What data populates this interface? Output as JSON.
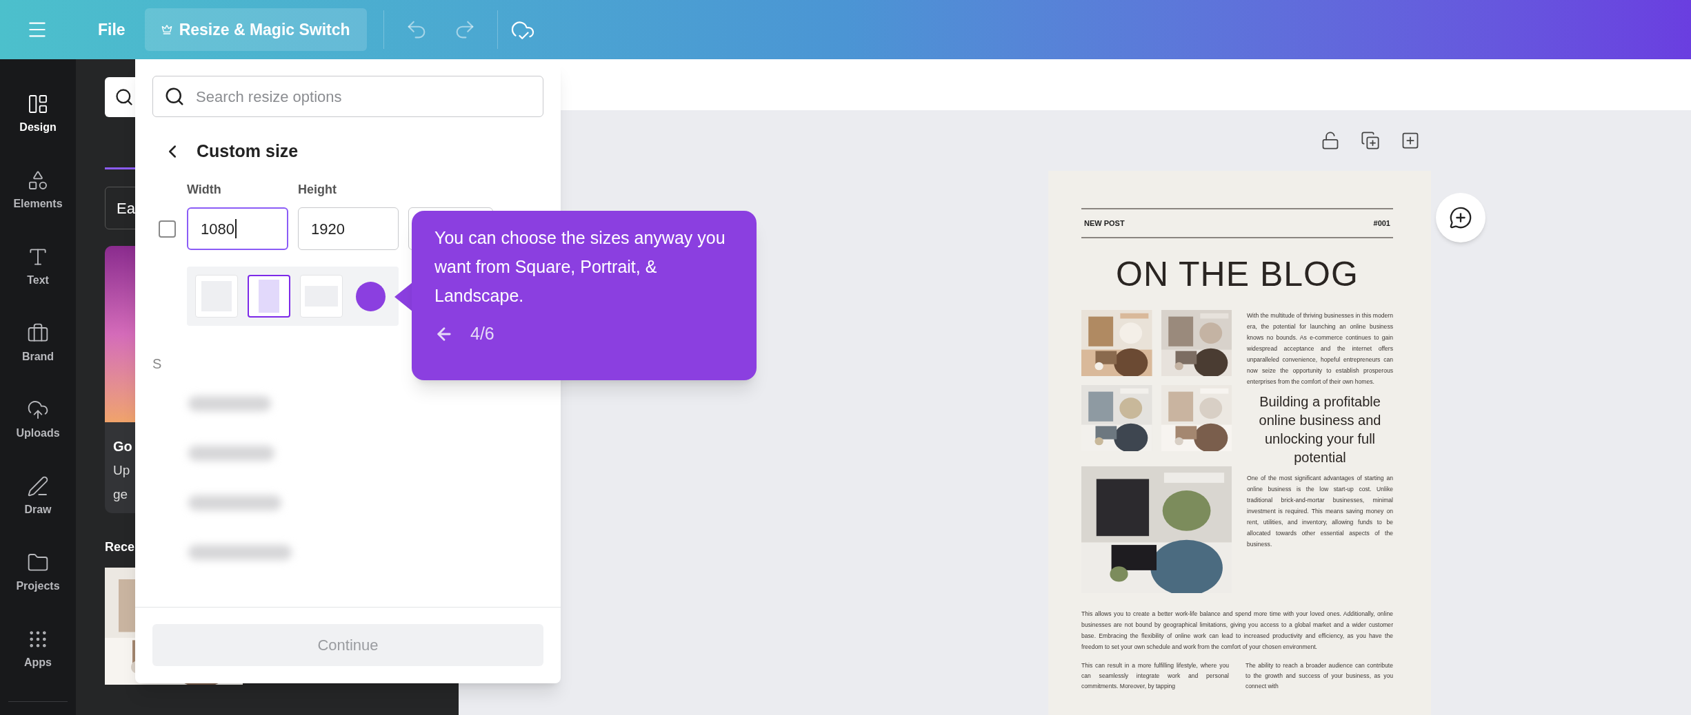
{
  "topbar": {
    "menu_items": [
      {
        "label": "File",
        "kind": "plain"
      },
      {
        "label": "Resize & Magic Switch",
        "kind": "highlight"
      }
    ]
  },
  "rail": [
    {
      "label": "Design",
      "selected": true
    },
    {
      "label": "Elements",
      "selected": false
    },
    {
      "label": "Text",
      "selected": false
    },
    {
      "label": "Brand",
      "selected": false
    },
    {
      "label": "Uploads",
      "selected": false
    },
    {
      "label": "Draw",
      "selected": false
    },
    {
      "label": "Projects",
      "selected": false
    },
    {
      "label": "Apps",
      "selected": false
    }
  ],
  "side_panel": {
    "dropdown_text": "Ea",
    "card": {
      "title": "Go",
      "lines": [
        "Up",
        "ge"
      ]
    },
    "section_title": "Rece"
  },
  "resize_popover": {
    "search": {
      "placeholder": "Search resize options"
    },
    "header": "Custom size",
    "width": {
      "label": "Width",
      "value": "1080"
    },
    "height": {
      "label": "Height",
      "value": "1920"
    },
    "lock_checked": false,
    "presets": [
      {
        "kind": "square",
        "selected": false
      },
      {
        "kind": "portrait",
        "selected": true
      },
      {
        "kind": "landscape",
        "selected": false
      }
    ],
    "section_letter": "S",
    "continue": {
      "label": "Continue",
      "disabled": true
    }
  },
  "tour_tip": {
    "text": "You can choose the sizes anyway you want from Square, Portrait, & Landscape.",
    "step": "4/6"
  },
  "page": {
    "tag": "NEW POST",
    "number": "#001",
    "title": "ON THE BLOG",
    "intro": "With the multitude of thriving businesses in this modern era, the potential for launching an online business knows no bounds. As e-commerce continues to gain widespread acceptance and the internet offers unparalleled convenience, hopeful entrepreneurs can now seize the opportunity to establish prosperous enterprises from the comfort of their own homes.",
    "heading": "Building a profitable online business and unlocking your full potential",
    "para2": "One of the most significant advantages of starting an online business is the low start-up cost. Unlike traditional brick-and-mortar businesses, minimal investment is required. This means saving money on rent, utilities, and inventory, allowing funds to be allocated towards other essential aspects of the business.",
    "para3": "This allows you to create a better work-life balance and spend more time with your loved ones. Additionally, online businesses are not bound by geographical limitations, giving you access to a global market and a wider customer base. Embracing the flexibility of online work can lead to increased productivity and efficiency, as you have the freedom to set your own schedule and work from the comfort of your chosen environment.",
    "col_left": "This can result in a more fulfilling lifestyle, where you can seamlessly integrate work and personal commitments. Moreover, by tapping",
    "col_right": "The ability to reach a broader audience can contribute to the growth and success of your business, as you connect with"
  }
}
